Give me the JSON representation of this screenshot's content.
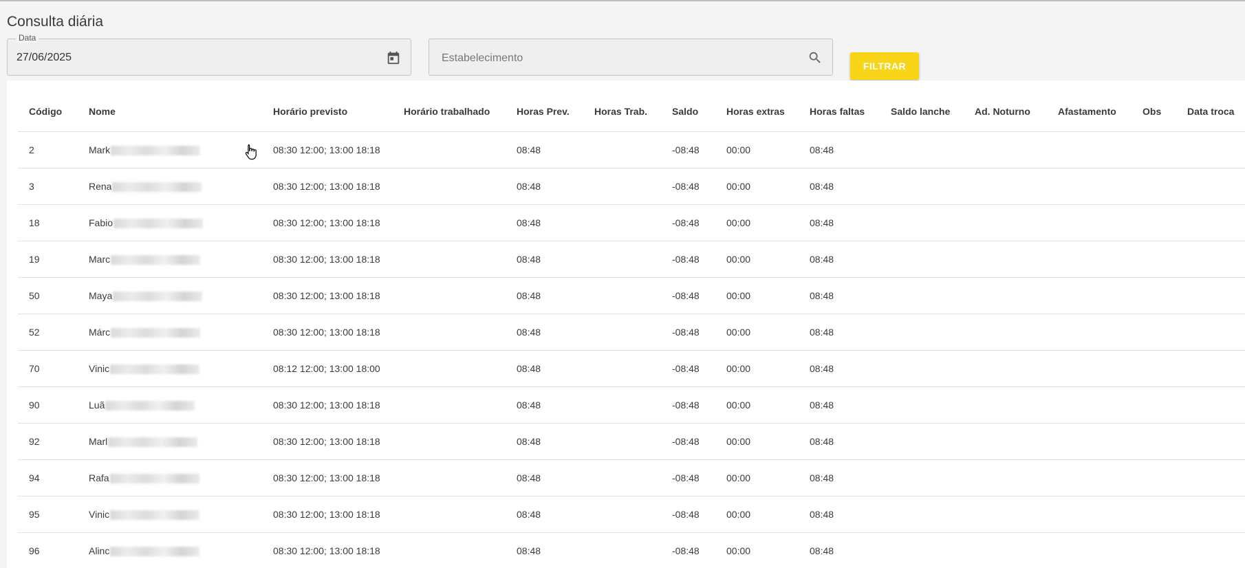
{
  "page": {
    "title": "Consulta diária"
  },
  "filters": {
    "date_label": "Data",
    "date_value": "27/06/2025",
    "estabelecimento_placeholder": "Estabelecimento",
    "filter_button": "FILTRAR"
  },
  "table": {
    "headers": [
      "Código",
      "Nome",
      "Horário previsto",
      "Horário trabalhado",
      "Horas Prev.",
      "Horas Trab.",
      "Saldo",
      "Horas extras",
      "Horas faltas",
      "Saldo lanche",
      "Ad. Noturno",
      "Afastamento",
      "Obs",
      "Data troca"
    ],
    "rows": [
      {
        "codigo": "2",
        "nome": "Mark",
        "horario_previsto": "08:30 12:00; 13:00 18:18",
        "horario_trabalhado": "",
        "horas_prev": "08:48",
        "horas_trab": "",
        "saldo": "-08:48",
        "horas_extras": "00:00",
        "horas_faltas": "08:48",
        "saldo_lanche": "",
        "ad_noturno": "",
        "afastamento": "",
        "obs": "",
        "data_troca": ""
      },
      {
        "codigo": "3",
        "nome": "Rena",
        "horario_previsto": "08:30 12:00; 13:00 18:18",
        "horario_trabalhado": "",
        "horas_prev": "08:48",
        "horas_trab": "",
        "saldo": "-08:48",
        "horas_extras": "00:00",
        "horas_faltas": "08:48",
        "saldo_lanche": "",
        "ad_noturno": "",
        "afastamento": "",
        "obs": "",
        "data_troca": ""
      },
      {
        "codigo": "18",
        "nome": "Fabio",
        "horario_previsto": "08:30 12:00; 13:00 18:18",
        "horario_trabalhado": "",
        "horas_prev": "08:48",
        "horas_trab": "",
        "saldo": "-08:48",
        "horas_extras": "00:00",
        "horas_faltas": "08:48",
        "saldo_lanche": "",
        "ad_noturno": "",
        "afastamento": "",
        "obs": "",
        "data_troca": ""
      },
      {
        "codigo": "19",
        "nome": "Marc",
        "horario_previsto": "08:30 12:00; 13:00 18:18",
        "horario_trabalhado": "",
        "horas_prev": "08:48",
        "horas_trab": "",
        "saldo": "-08:48",
        "horas_extras": "00:00",
        "horas_faltas": "08:48",
        "saldo_lanche": "",
        "ad_noturno": "",
        "afastamento": "",
        "obs": "",
        "data_troca": ""
      },
      {
        "codigo": "50",
        "nome": "Maya",
        "horario_previsto": "08:30 12:00; 13:00 18:18",
        "horario_trabalhado": "",
        "horas_prev": "08:48",
        "horas_trab": "",
        "saldo": "-08:48",
        "horas_extras": "00:00",
        "horas_faltas": "08:48",
        "saldo_lanche": "",
        "ad_noturno": "",
        "afastamento": "",
        "obs": "",
        "data_troca": ""
      },
      {
        "codigo": "52",
        "nome": "Márc",
        "horario_previsto": "08:30 12:00; 13:00 18:18",
        "horario_trabalhado": "",
        "horas_prev": "08:48",
        "horas_trab": "",
        "saldo": "-08:48",
        "horas_extras": "00:00",
        "horas_faltas": "08:48",
        "saldo_lanche": "",
        "ad_noturno": "",
        "afastamento": "",
        "obs": "",
        "data_troca": ""
      },
      {
        "codigo": "70",
        "nome": "Vinic",
        "horario_previsto": "08:12 12:00; 13:00 18:00",
        "horario_trabalhado": "",
        "horas_prev": "08:48",
        "horas_trab": "",
        "saldo": "-08:48",
        "horas_extras": "00:00",
        "horas_faltas": "08:48",
        "saldo_lanche": "",
        "ad_noturno": "",
        "afastamento": "",
        "obs": "",
        "data_troca": ""
      },
      {
        "codigo": "90",
        "nome": "Luã",
        "horario_previsto": "08:30 12:00; 13:00 18:18",
        "horario_trabalhado": "",
        "horas_prev": "08:48",
        "horas_trab": "",
        "saldo": "-08:48",
        "horas_extras": "00:00",
        "horas_faltas": "08:48",
        "saldo_lanche": "",
        "ad_noturno": "",
        "afastamento": "",
        "obs": "",
        "data_troca": ""
      },
      {
        "codigo": "92",
        "nome": "Marl",
        "horario_previsto": "08:30 12:00; 13:00 18:18",
        "horario_trabalhado": "",
        "horas_prev": "08:48",
        "horas_trab": "",
        "saldo": "-08:48",
        "horas_extras": "00:00",
        "horas_faltas": "08:48",
        "saldo_lanche": "",
        "ad_noturno": "",
        "afastamento": "",
        "obs": "",
        "data_troca": ""
      },
      {
        "codigo": "94",
        "nome": "Rafa",
        "horario_previsto": "08:30 12:00; 13:00 18:18",
        "horario_trabalhado": "",
        "horas_prev": "08:48",
        "horas_trab": "",
        "saldo": "-08:48",
        "horas_extras": "00:00",
        "horas_faltas": "08:48",
        "saldo_lanche": "",
        "ad_noturno": "",
        "afastamento": "",
        "obs": "",
        "data_troca": ""
      },
      {
        "codigo": "95",
        "nome": "Vinic",
        "horario_previsto": "08:30 12:00; 13:00 18:18",
        "horario_trabalhado": "",
        "horas_prev": "08:48",
        "horas_trab": "",
        "saldo": "-08:48",
        "horas_extras": "00:00",
        "horas_faltas": "08:48",
        "saldo_lanche": "",
        "ad_noturno": "",
        "afastamento": "",
        "obs": "",
        "data_troca": ""
      },
      {
        "codigo": "96",
        "nome": "Alinc",
        "horario_previsto": "08:30 12:00; 13:00 18:18",
        "horario_trabalhado": "",
        "horas_prev": "08:48",
        "horas_trab": "",
        "saldo": "-08:48",
        "horas_extras": "00:00",
        "horas_faltas": "08:48",
        "saldo_lanche": "",
        "ad_noturno": "",
        "afastamento": "",
        "obs": "",
        "data_troca": ""
      }
    ]
  },
  "icons": {
    "date": "calendar-icon",
    "search": "search-icon",
    "cursor": "hand-cursor-icon"
  }
}
